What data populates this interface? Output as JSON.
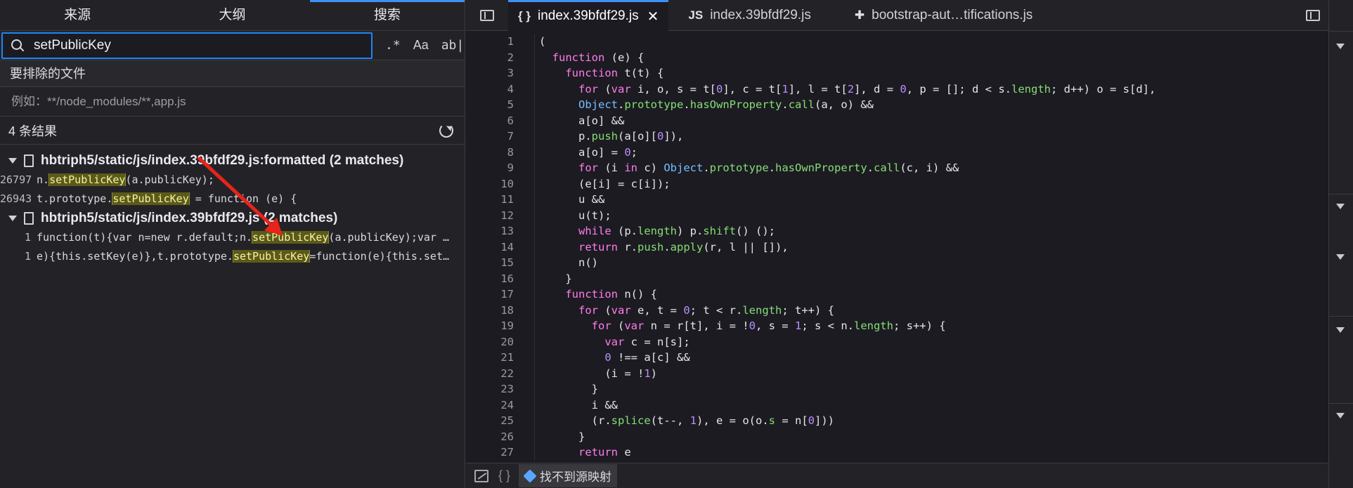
{
  "left_panel": {
    "tabs": [
      {
        "label": "来源",
        "active": false
      },
      {
        "label": "大纲",
        "active": false
      },
      {
        "label": "搜索",
        "active": true
      }
    ],
    "search": {
      "value": "setPublicKey",
      "opt_regex": ".*",
      "opt_case": "Aa",
      "opt_word": "ab|"
    },
    "exclude_label": "要排除的文件",
    "exclude_placeholder": "例如：**/node_modules/**,app.js",
    "result_count": "4 条结果",
    "groups": [
      {
        "file": "hbtriph5/static/js/index.39bfdf29.js:formatted (2 matches)",
        "matches": [
          {
            "line": "26797",
            "before": "n.",
            "hit": "setPublicKey",
            "after": "(a.publicKey);"
          },
          {
            "line": "26943",
            "before": "t.prototype.",
            "hit": "setPublicKey",
            "after": " = function (e) {"
          }
        ]
      },
      {
        "file": "hbtriph5/static/js/index.39bfdf29.js (2 matches)",
        "matches": [
          {
            "line": "1",
            "before": "function(t){var n=new r.default;n.",
            "hit": "setPublicKey",
            "after": "(a.publicKey);var …"
          },
          {
            "line": "1",
            "before": "e){this.setKey(e)},t.prototype.",
            "hit": "setPublicKey",
            "after": "=function(e){this.set…"
          }
        ]
      }
    ]
  },
  "editor": {
    "tabs": [
      {
        "icon": "{ }",
        "label": "index.39bfdf29.js",
        "active": true,
        "closable": true
      },
      {
        "icon": "JS",
        "label": "index.39bfdf29.js",
        "active": false,
        "closable": false
      },
      {
        "icon": "puzzle",
        "label": "bootstrap-aut…tifications.js",
        "active": false,
        "closable": false
      }
    ],
    "close_glyph": "✕",
    "footer_brace": "{ }",
    "footer_status": "找不到源映射",
    "code_lines": [
      "(",
      "  function (e) {",
      "    function t(t) {",
      "      for (var i, o, s = t[0], c = t[1], l = t[2], d = 0, p = []; d < s.length; d++) o = s[d],",
      "      Object.prototype.hasOwnProperty.call(a, o) &&",
      "      a[o] &&",
      "      p.push(a[o][0]),",
      "      a[o] = 0;",
      "      for (i in c) Object.prototype.hasOwnProperty.call(c, i) &&",
      "      (e[i] = c[i]);",
      "      u &&",
      "      u(t);",
      "      while (p.length) p.shift() ();",
      "      return r.push.apply(r, l || []),",
      "      n()",
      "    }",
      "    function n() {",
      "      for (var e, t = 0; t < r.length; t++) {",
      "        for (var n = r[t], i = !0, s = 1; s < n.length; s++) {",
      "          var c = n[s];",
      "          0 !== a[c] &&",
      "          (i = !1)",
      "        }",
      "        i &&",
      "        (r.splice(t--, 1), e = o(o.s = n[0]))",
      "      }",
      "      return e"
    ]
  },
  "colors": {
    "accent": "#3f8ff5",
    "match_bg": "#5c5a1a",
    "arrow": "#e8231c"
  }
}
